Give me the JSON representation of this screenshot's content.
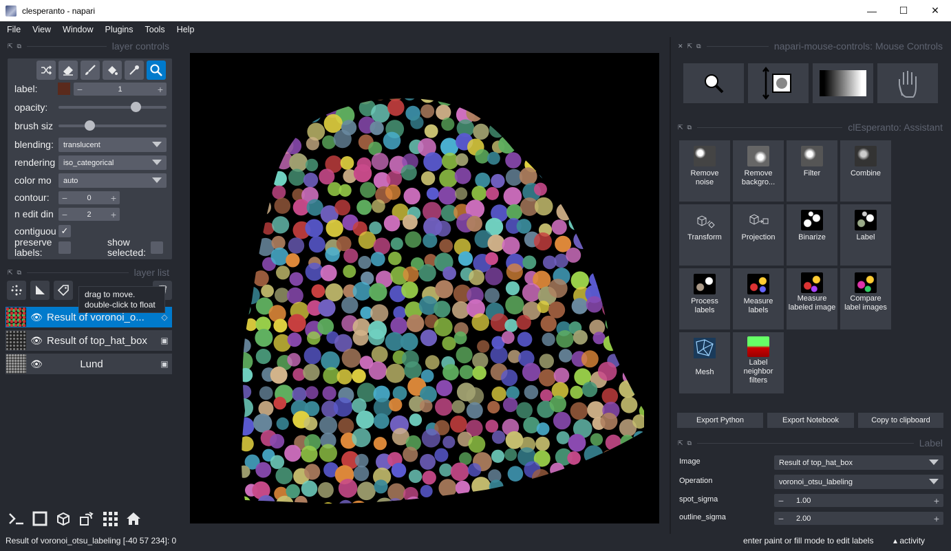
{
  "window": {
    "title": "clesperanto - napari",
    "minimize": "—",
    "maximize": "☐",
    "close": "✕"
  },
  "menu": [
    "File",
    "View",
    "Window",
    "Plugins",
    "Tools",
    "Help"
  ],
  "layer_controls": {
    "header": "layer controls",
    "label_label": "label:",
    "label_value": "1",
    "label_color": "#5a2a1c",
    "opacity_label": "opacity:",
    "opacity_value": 0.74,
    "brush_label": "brush siz",
    "brush_value": 0.27,
    "blending_label": "blending:",
    "blending_value": "translucent",
    "rendering_label": "rendering",
    "rendering_value": "iso_categorical",
    "colormode_label": "color mo",
    "colormode_value": "auto",
    "contour_label": "contour:",
    "contour_value": "0",
    "ndim_label": "n edit din",
    "ndim_value": "2",
    "contiguous_label": "contiguou",
    "contiguous_checked": true,
    "preserve_label": "preserve labels:",
    "preserve_checked": false,
    "show_selected_label": "show selected:",
    "show_selected_checked": false,
    "tools": [
      "shuffle-icon",
      "eraser-icon",
      "paintbrush-icon",
      "fill-bucket-icon",
      "picker-icon",
      "zoom-icon"
    ]
  },
  "layer_list": {
    "header": "layer list",
    "tooltip_line1": "drag to move.",
    "tooltip_line2": "double-click to float",
    "layers": [
      {
        "name": "Result of voronoi_o...",
        "type_icon": "label-icon",
        "selected": true
      },
      {
        "name": "Result of top_hat_box",
        "type_icon": "image-icon",
        "selected": false
      },
      {
        "name": "Lund",
        "type_icon": "image-icon",
        "selected": false
      }
    ]
  },
  "mouse_controls": {
    "header": "napari-mouse-controls: Mouse Controls"
  },
  "assistant": {
    "header": "clEsperanto: Assistant",
    "tiles": [
      {
        "label": "Remove noise",
        "icon": "remove-noise-icon"
      },
      {
        "label": "Remove backgro...",
        "icon": "remove-background-icon"
      },
      {
        "label": "Filter",
        "icon": "filter-icon"
      },
      {
        "label": "Combine",
        "icon": "combine-icon"
      },
      {
        "label": "Transform",
        "icon": "transform-icon"
      },
      {
        "label": "Projection",
        "icon": "projection-icon"
      },
      {
        "label": "Binarize",
        "icon": "binarize-icon"
      },
      {
        "label": "Label",
        "icon": "label-icon"
      },
      {
        "label": "Process labels",
        "icon": "process-labels-icon"
      },
      {
        "label": "Measure labels",
        "icon": "measure-labels-icon"
      },
      {
        "label": "Measure labeled image",
        "icon": "measure-labeled-image-icon"
      },
      {
        "label": "Compare label images",
        "icon": "compare-label-images-icon"
      },
      {
        "label": "Mesh",
        "icon": "mesh-icon"
      },
      {
        "label": "Label neighbor filters",
        "icon": "label-neighbor-filters-icon"
      }
    ],
    "export_python": "Export Python",
    "export_notebook": "Export Notebook",
    "copy_clipboard": "Copy to clipboard"
  },
  "label_widget": {
    "header": "Label",
    "image_label": "Image",
    "image_value": "Result of top_hat_box",
    "operation_label": "Operation",
    "operation_value": "voronoi_otsu_labeling",
    "spot_sigma_label": "spot_sigma",
    "spot_sigma_value": "1.00",
    "outline_sigma_label": "outline_sigma",
    "outline_sigma_value": "2.00"
  },
  "status": {
    "left": "Result of voronoi_otsu_labeling [-40  57 234]: 0",
    "right": "enter paint or fill mode to edit labels",
    "activity": "activity"
  },
  "colors": {
    "accent": "#007acc",
    "background": "#262930",
    "panel": "#3b3f48",
    "control": "#595d69"
  }
}
